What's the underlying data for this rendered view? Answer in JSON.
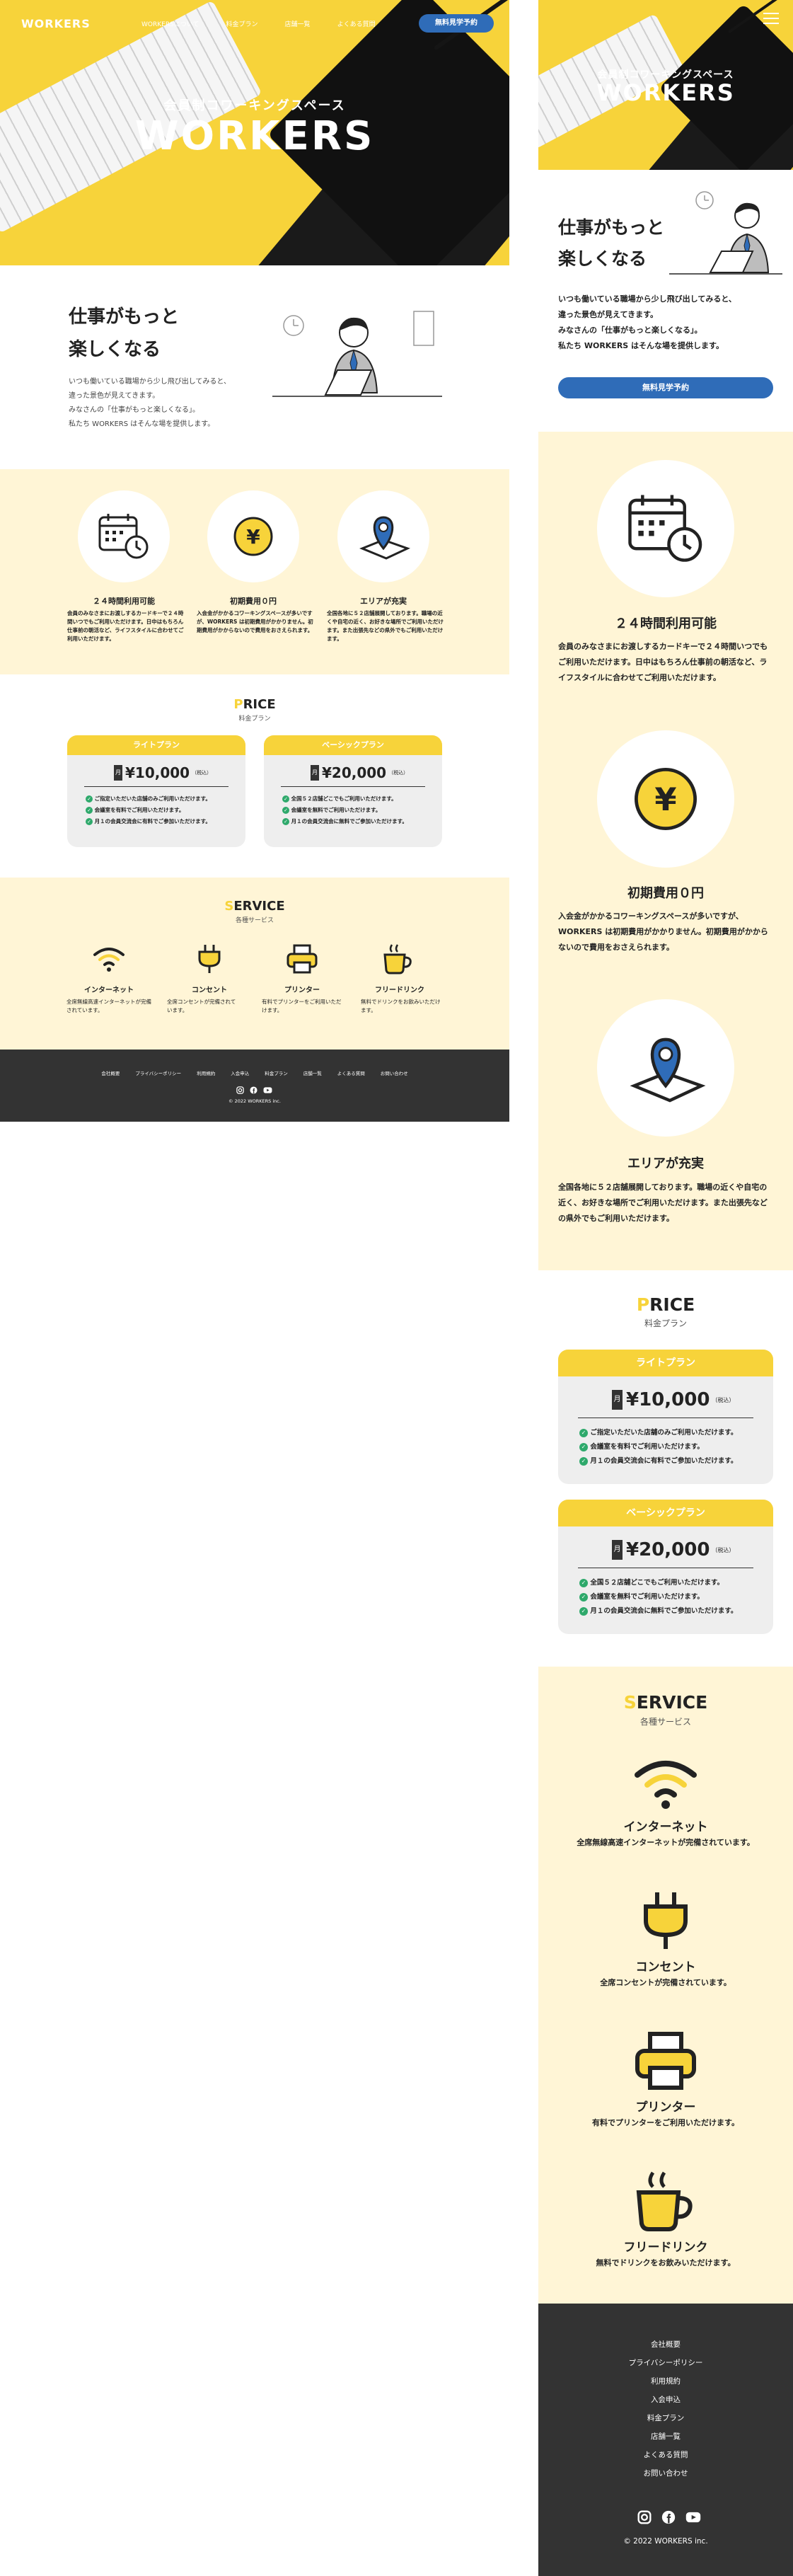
{
  "brand": "WORKERS",
  "nav": {
    "items": [
      "WORKERSについて",
      "料金プラン",
      "店舗一覧",
      "よくある質問"
    ],
    "cta": "無料見学予約"
  },
  "hero": {
    "subtitle": "会員制コワーキングスペース",
    "title": "WORKERS"
  },
  "intro": {
    "heading_line1": "仕事がもっと",
    "heading_line2": "楽しくなる",
    "body_line1": "いつも働いている職場から少し飛び出してみると、",
    "body_line2": "違った景色が見えてきます。",
    "body_line3": "みなさんの「仕事がもっと楽しくなる」。",
    "body_line4": "私たち WORKERS はそんな場を提供します。",
    "cta": "無料見学予約"
  },
  "features": [
    {
      "icon": "calendar-clock-icon",
      "title": "２４時間利用可能",
      "text": "会員のみなさまにお渡しするカードキーで２４時間いつでもご利用いただけます。日中はもちろん仕事前の朝活など、ライフスタイルに合わせてご利用いただけます。"
    },
    {
      "icon": "yen-coin-icon",
      "title": "初期費用０円",
      "text": "入会金がかかるコワーキングスペースが多いですが、WORKERS は初期費用がかかりません。初期費用がかからないので費用をおさえられます。"
    },
    {
      "icon": "map-pin-icon",
      "title": "エリアが充実",
      "text": "全国各地に５２店舗展開しております。職場の近くや自宅の近く、お好きな場所でご利用いただけます。また出張先などの県外でもご利用いただけます。"
    }
  ],
  "price": {
    "title_first": "P",
    "title_rest": "RICE",
    "subtitle": "料金プラン",
    "plans": [
      {
        "name": "ライトプラン",
        "price": "¥10,000",
        "tax": "（税込）",
        "features": [
          "ご指定いただいた店舗のみご利用いただけます。",
          "会議室を有料でご利用いただけます。",
          "月１の会員交流会に有料でご参加いただけます。"
        ]
      },
      {
        "name": "ベーシックプラン",
        "price": "¥20,000",
        "tax": "（税込）",
        "features": [
          "全国５２店舗どこでもご利用いただけます。",
          "会議室を無料でご利用いただけます。",
          "月１の会員交流会に無料でご参加いただけます。"
        ]
      }
    ],
    "month_badge": "月"
  },
  "service": {
    "title_first": "S",
    "title_rest": "ERVICE",
    "subtitle": "各種サービス",
    "items": [
      {
        "icon": "wifi-icon",
        "title": "インターネット",
        "text": "全席無線高速インターネットが完備されています。"
      },
      {
        "icon": "plug-icon",
        "title": "コンセント",
        "text": "全席コンセントが完備されています。"
      },
      {
        "icon": "printer-icon",
        "title": "プリンター",
        "text": "有料でプリンターをご利用いただけます。"
      },
      {
        "icon": "coffee-icon",
        "title": "フリードリンク",
        "text": "無料でドリンクをお飲みいただけます。"
      }
    ]
  },
  "footer": {
    "links": [
      "会社概要",
      "プライバシーポリシー",
      "利用規約",
      "入会申込",
      "料金プラン",
      "店舗一覧",
      "よくある質問",
      "お問い合わせ"
    ],
    "copyright": "© 2022 WORKERS inc."
  },
  "colors": {
    "yellow": "#f7d33a",
    "cream": "#fff5d6",
    "blue": "#2f6cb8",
    "dark": "#333333",
    "green": "#2ea96b"
  }
}
